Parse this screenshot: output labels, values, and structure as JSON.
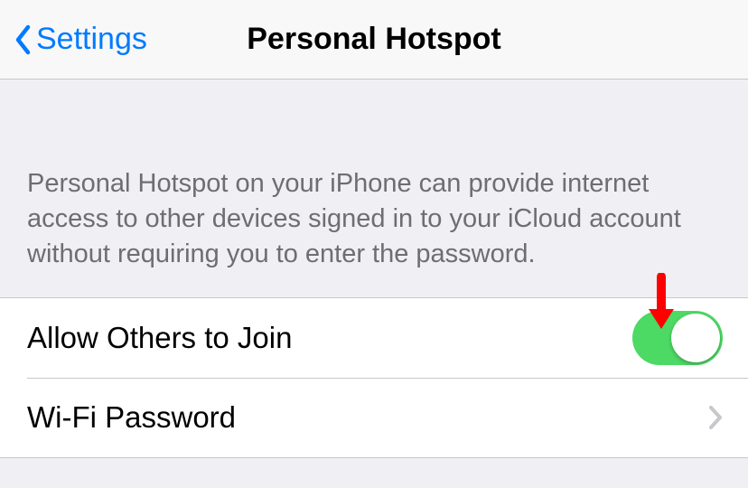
{
  "nav": {
    "back_label": "Settings",
    "title": "Personal Hotspot"
  },
  "description": "Personal Hotspot on your iPhone can provide internet access to other devices signed in to your iCloud account without requiring you to enter the password.",
  "rows": {
    "allow_others": {
      "label": "Allow Others to Join",
      "toggle_on": true
    },
    "wifi_password": {
      "label": "Wi-Fi Password"
    }
  },
  "colors": {
    "tint": "#007aff",
    "toggle_on": "#4cd964",
    "annotation": "#ff0000"
  }
}
